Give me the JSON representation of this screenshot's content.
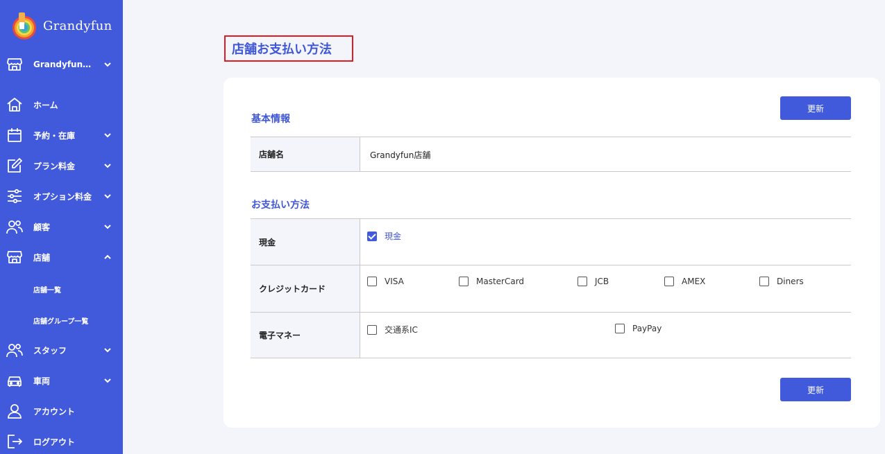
{
  "app": {
    "name": "Grandyfun"
  },
  "sidebar": {
    "store_selector": "Grandyfun…",
    "items": [
      {
        "label": "ホーム"
      },
      {
        "label": "予約・在庫"
      },
      {
        "label": "プラン料金"
      },
      {
        "label": "オプション料金"
      },
      {
        "label": "顧客"
      },
      {
        "label": "店舗"
      },
      {
        "label": "スタッフ"
      },
      {
        "label": "車両"
      },
      {
        "label": "アカウント"
      },
      {
        "label": "ログアウト"
      }
    ],
    "store_sub_items": [
      {
        "label": "店舗一覧"
      },
      {
        "label": "店舗グループ一覧"
      }
    ]
  },
  "page": {
    "title": "店舗お支払い方法",
    "update_button": "更新",
    "basic_info": {
      "heading": "基本情報",
      "store_name_label": "店舗名",
      "store_name_value": "Grandyfun店舗"
    },
    "payment": {
      "heading": "お支払い方法",
      "cash": {
        "label": "現金",
        "options": [
          {
            "label": "現金",
            "checked": true
          }
        ]
      },
      "credit": {
        "label": "クレジットカード",
        "options": [
          {
            "label": "VISA",
            "checked": false
          },
          {
            "label": "MasterCard",
            "checked": false
          },
          {
            "label": "JCB",
            "checked": false
          },
          {
            "label": "AMEX",
            "checked": false
          },
          {
            "label": "Diners",
            "checked": false
          }
        ]
      },
      "emoney": {
        "label": "電子マネー",
        "options": [
          {
            "label": "交通系IC",
            "checked": false
          },
          {
            "label": "PayPay",
            "checked": false
          }
        ]
      }
    }
  },
  "colors": {
    "sidebar": "#4159db",
    "accent": "#3f57d6",
    "highlight_border": "#e11b22",
    "background": "#f3f5fb"
  }
}
